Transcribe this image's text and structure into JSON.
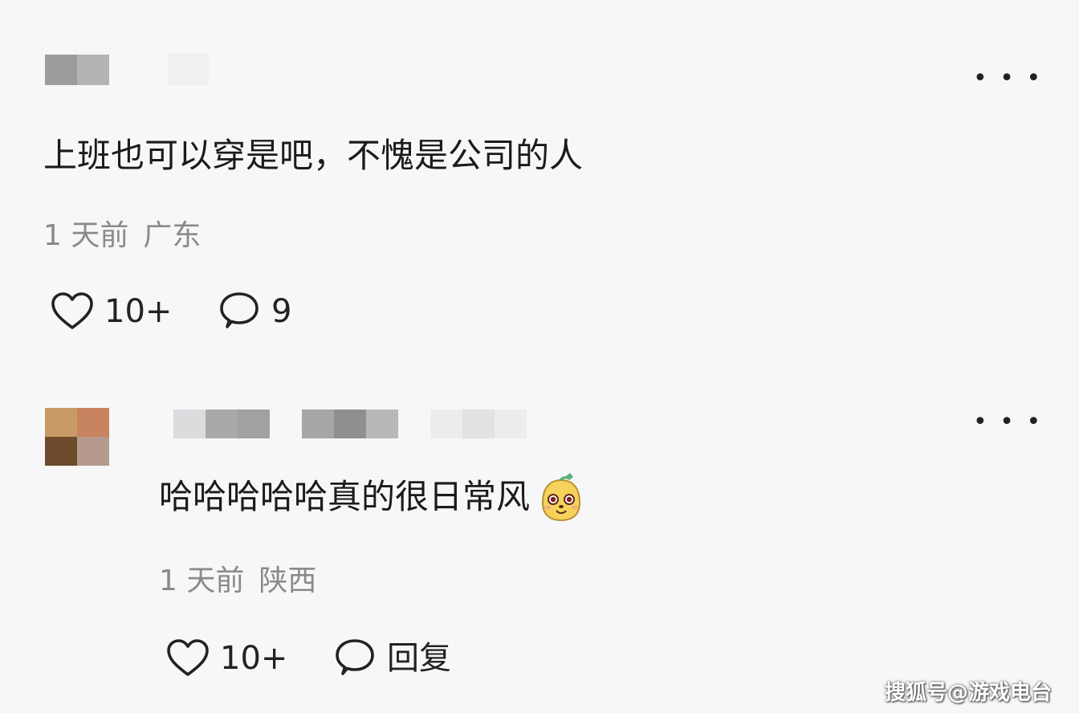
{
  "comments": [
    {
      "text": "上班也可以穿是吧，不愧是公司的人",
      "time": "1 天前",
      "region": "广东",
      "likes": "10+",
      "replies": "9"
    },
    {
      "text": "哈哈哈哈哈真的很日常风",
      "emoji": "smiling-face-sticker",
      "time": "1 天前",
      "region": "陕西",
      "likes": "10+",
      "reply_label": "回复"
    }
  ],
  "more_label": "• • •",
  "watermark": "搜狐号@游戏电台",
  "colors": {
    "background": "#f7f7f9",
    "text": "#1b1b1b",
    "meta": "#8a8a8a"
  }
}
